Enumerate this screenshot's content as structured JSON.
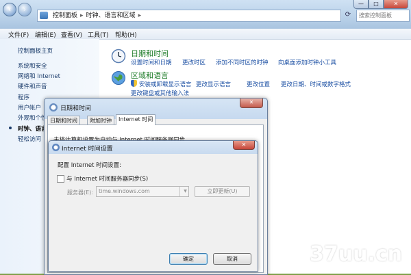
{
  "control_panel": {
    "address": [
      "控制面板",
      "时钟、语言和区域"
    ],
    "search_placeholder": "搜索控制面板",
    "caption": {
      "minimize": "—",
      "maximize": "□",
      "close": "✕"
    },
    "menu": [
      "文件(F)",
      "编辑(E)",
      "查看(V)",
      "工具(T)",
      "帮助(H)"
    ],
    "sidebar": [
      {
        "label": "控制面板主页"
      },
      {
        "label": "系统和安全"
      },
      {
        "label": "网络和 Internet"
      },
      {
        "label": "硬件和声音"
      },
      {
        "label": "程序"
      },
      {
        "label": "用户帐户"
      },
      {
        "label": "外观和个性"
      },
      {
        "label": "时钟、语言"
      },
      {
        "label": "轻松访问"
      }
    ],
    "categories": {
      "datetime": {
        "title": "日期和时间",
        "links": [
          "设置时间和日期",
          "更改时区",
          "添加不同时区的时钟",
          "向桌面添加时钟小工具"
        ]
      },
      "region": {
        "title": "区域和语言",
        "links": [
          "安装或卸载显示语言",
          "更改显示语言",
          "更改位置",
          "更改日期、时间或数字格式"
        ],
        "extra_link": "更改键盘或其他输入法"
      }
    }
  },
  "datetime_dialog": {
    "title": "日期和时间",
    "close": "✕",
    "tabs": [
      "日期和时间",
      "附加时钟",
      "Internet 时间"
    ],
    "panel_text": "未将计算机设置为自动与 Internet 时间服务器同步。"
  },
  "internet_time_dialog": {
    "title": "Internet 时间设置",
    "close": "✕",
    "heading": "配置 Internet 时间设置:",
    "sync_label": "与 Internet 时间服务器同步(S)",
    "sync_checked": false,
    "server_label": "服务器(E):",
    "server_value": "time.windows.com",
    "update_button": "立即更新(U)",
    "ok_button": "确定",
    "cancel_button": "取消"
  },
  "watermark": {
    "ghost": "十巴兔",
    "text": "37uu.cn"
  }
}
